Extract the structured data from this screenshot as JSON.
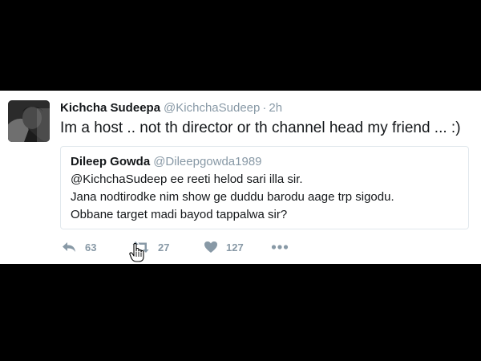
{
  "tweet": {
    "author_name": "Kichcha Sudeepa",
    "author_handle": "@KichchaSudeep",
    "separator": "·",
    "timestamp": "2h",
    "text": "Im a host .. not th director or th channel head my friend ... :)",
    "quoted": {
      "author_name": "Dileep Gowda",
      "author_handle": "@Dileepgowda1989",
      "lines": [
        "@KichchaSudeep ee reeti helod sari illa sir.",
        "Jana nodtirodke nim show ge duddu barodu aage trp sigodu.",
        "Obbane target madi bayod tappalwa sir?"
      ]
    },
    "actions": {
      "reply_count": "63",
      "retweet_count": "27",
      "like_count": "127"
    }
  },
  "colors": {
    "background": "#000000",
    "card": "#ffffff",
    "text": "#14171a",
    "muted": "#8899a6",
    "border": "#e1e8ed"
  },
  "icons": {
    "reply": "reply-icon",
    "retweet": "retweet-icon",
    "like": "heart-icon",
    "more": "more-icon",
    "cursor": "hand-cursor-icon"
  }
}
